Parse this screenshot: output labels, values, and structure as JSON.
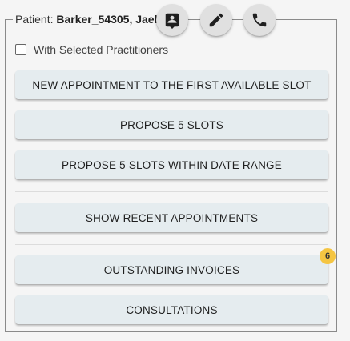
{
  "patient": {
    "prefix": "Patient: ",
    "name": "Barker_54305, Jael"
  },
  "header_actions": [
    {
      "icon": "contact-card-icon"
    },
    {
      "icon": "edit-pencil-icon"
    },
    {
      "icon": "phone-icon"
    }
  ],
  "options": {
    "with_selected_practitioners": "With Selected Practitioners",
    "checked": false
  },
  "buttons": {
    "new_appointment": "NEW APPOINTMENT TO THE FIRST AVAILABLE SLOT",
    "propose_5_slots": "PROPOSE 5 SLOTS",
    "propose_5_slots_range": "PROPOSE 5 SLOTS WITHIN DATE RANGE",
    "show_recent": "SHOW RECENT APPOINTMENTS",
    "outstanding_invoices": "OUTSTANDING INVOICES",
    "consultations": "CONSULTATIONS"
  },
  "badges": {
    "outstanding_invoices_count": "6"
  },
  "colors": {
    "button_bg": "#e5ecef",
    "badge_bg": "#f5c542",
    "icon_button_bg": "#e0e0e0"
  }
}
